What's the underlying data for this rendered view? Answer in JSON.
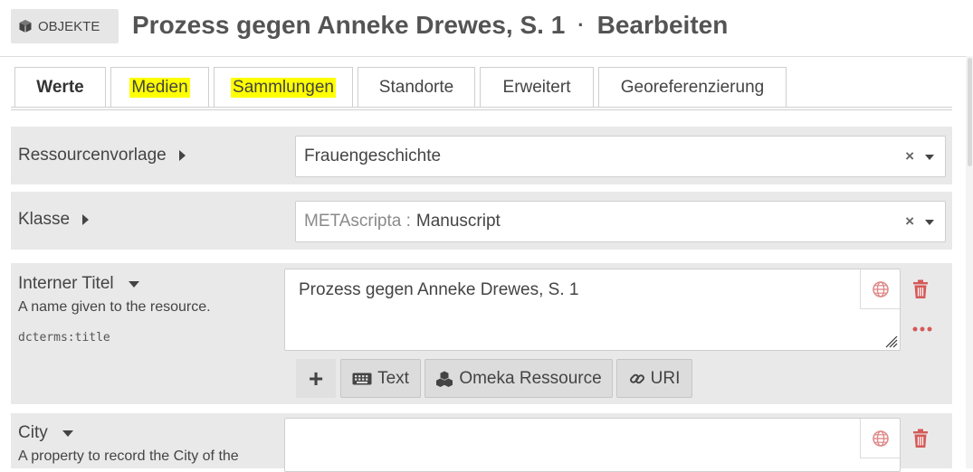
{
  "header": {
    "section_label": "OBJEKTE",
    "title": "Prozess gegen Anneke Drewes, S. 1",
    "separator": "·",
    "action": "Bearbeiten"
  },
  "tabs": [
    {
      "label": "Werte",
      "active": true
    },
    {
      "label": "Medien",
      "highlighted": true
    },
    {
      "label": "Sammlungen",
      "highlighted": true
    },
    {
      "label": "Standorte"
    },
    {
      "label": "Erweitert"
    },
    {
      "label": "Georeferenzierung"
    }
  ],
  "fields": {
    "resource_template": {
      "label": "Ressourcenvorlage",
      "value": "Frauengeschichte",
      "clear": "×"
    },
    "class": {
      "label": "Klasse",
      "prefix": "METAscripta :",
      "value": "Manuscript",
      "clear": "×"
    },
    "title": {
      "label": "Interner Titel",
      "description": "A name given to the resource.",
      "term": "dcterms:title",
      "value": "Prozess gegen Anneke Drewes, S. 1"
    },
    "city": {
      "label": "City",
      "description": "A property to record the City of the",
      "value": ""
    }
  },
  "value_types": {
    "add": "+",
    "text": "Text",
    "omeka": "Omeka Ressource",
    "uri": "URI"
  },
  "colors": {
    "highlight": "#ffff00",
    "danger": "#d45a5a",
    "row_bg": "#e9e9e9"
  }
}
